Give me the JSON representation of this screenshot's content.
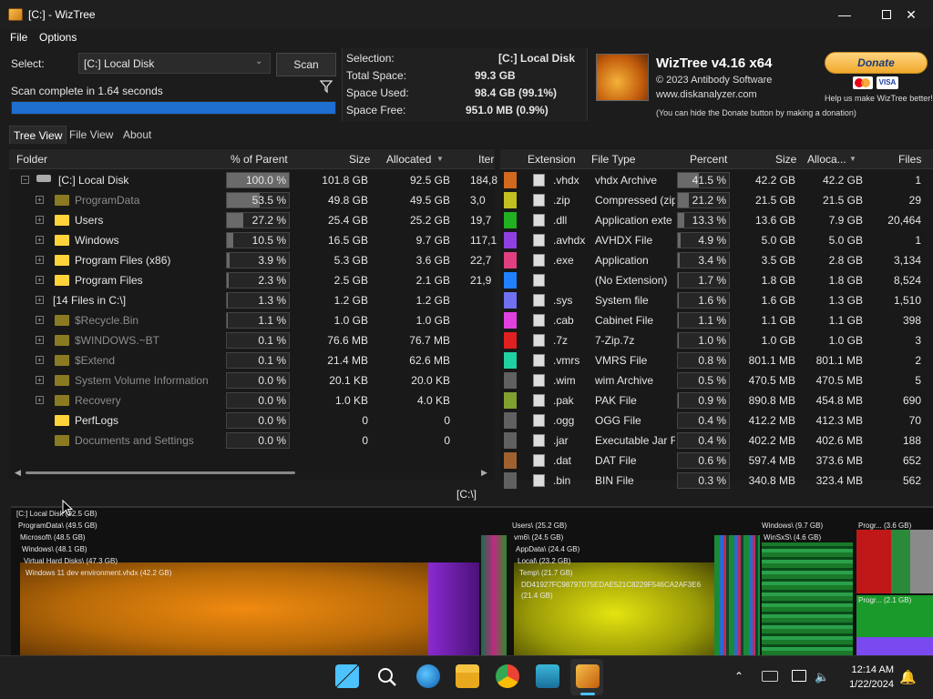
{
  "window": {
    "title": "[C:]  - WizTree",
    "min_icon": "minimize-icon",
    "max_icon": "maximize-icon",
    "close_icon": "close-icon"
  },
  "menu": {
    "file": "File",
    "options": "Options"
  },
  "scan": {
    "select_label": "Select:",
    "drive": "[C:] Local Disk",
    "scan_label": "Scan",
    "status": "Scan complete in 1.64 seconds",
    "progress": 1.0
  },
  "info": {
    "selection_label": "Selection:",
    "selection_value": "[C:]  Local Disk",
    "total_label": "Total Space:",
    "total_value": "99.3 GB",
    "used_label": "Space Used:",
    "used_value": "98.4 GB  (99.1%)",
    "free_label": "Space Free:",
    "free_value": "951.0 MB  (0.9%)"
  },
  "brand": {
    "name": "WizTree v4.16 x64",
    "copyright": "© 2023 Antibody Software",
    "url": "www.diskanalyzer.com",
    "note": "(You can hide the Donate button by making a donation)"
  },
  "donate": {
    "label": "Donate",
    "visa": "VISA",
    "help": "Help us make WizTree better!"
  },
  "tabs": [
    "Tree View",
    "File View",
    "About"
  ],
  "tree": {
    "headers": {
      "folder": "Folder",
      "pct": "% of Parent",
      "size": "Size",
      "allocated": "Allocated",
      "items": "Iter"
    },
    "rows": [
      {
        "name": "[C:] Local Disk",
        "pct": "100.0 %",
        "pct_val": 1.0,
        "size": "101.8 GB",
        "alloc": "92.5 GB",
        "items": "184,8",
        "kind": "drive"
      },
      {
        "name": "ProgramData",
        "pct": "53.5 %",
        "pct_val": 0.535,
        "size": "49.8 GB",
        "alloc": "49.5 GB",
        "items": "3,0",
        "kind": "sys"
      },
      {
        "name": "Users",
        "pct": "27.2 %",
        "pct_val": 0.272,
        "size": "25.4 GB",
        "alloc": "25.2 GB",
        "items": "19,7",
        "kind": "folder"
      },
      {
        "name": "Windows",
        "pct": "10.5 %",
        "pct_val": 0.105,
        "size": "16.5 GB",
        "alloc": "9.7 GB",
        "items": "117,1",
        "kind": "folder"
      },
      {
        "name": "Program Files (x86)",
        "pct": "3.9 %",
        "pct_val": 0.039,
        "size": "5.3 GB",
        "alloc": "3.6 GB",
        "items": "22,7",
        "kind": "folder"
      },
      {
        "name": "Program Files",
        "pct": "2.3 %",
        "pct_val": 0.023,
        "size": "2.5 GB",
        "alloc": "2.1 GB",
        "items": "21,9",
        "kind": "folder"
      },
      {
        "name": "[14 Files in C:\\]",
        "pct": "1.3 %",
        "pct_val": 0.013,
        "size": "1.2 GB",
        "alloc": "1.2 GB",
        "items": "",
        "kind": "files"
      },
      {
        "name": "$Recycle.Bin",
        "pct": "1.1 %",
        "pct_val": 0.011,
        "size": "1.0 GB",
        "alloc": "1.0 GB",
        "items": "",
        "kind": "sys"
      },
      {
        "name": "$WINDOWS.~BT",
        "pct": "0.1 %",
        "pct_val": 0.001,
        "size": "76.6 MB",
        "alloc": "76.7 MB",
        "items": "",
        "kind": "sys"
      },
      {
        "name": "$Extend",
        "pct": "0.1 %",
        "pct_val": 0.001,
        "size": "21.4 MB",
        "alloc": "62.6 MB",
        "items": "",
        "kind": "sys"
      },
      {
        "name": "System Volume Information",
        "pct": "0.0 %",
        "pct_val": 0.0,
        "size": "20.1 KB",
        "alloc": "20.0 KB",
        "items": "",
        "kind": "sys"
      },
      {
        "name": "Recovery",
        "pct": "0.0 %",
        "pct_val": 0.0,
        "size": "1.0 KB",
        "alloc": "4.0 KB",
        "items": "",
        "kind": "sys"
      },
      {
        "name": "PerfLogs",
        "pct": "0.0 %",
        "pct_val": 0.0,
        "size": "0",
        "alloc": "0",
        "items": "",
        "kind": "folder"
      },
      {
        "name": "Documents and Settings",
        "pct": "0.0 %",
        "pct_val": 0.0,
        "size": "0",
        "alloc": "0",
        "items": "",
        "kind": "sys"
      }
    ]
  },
  "ext": {
    "headers": {
      "extension": "Extension",
      "type": "File Type",
      "percent": "Percent",
      "size": "Size",
      "alloc": "Alloca...",
      "files": "Files"
    },
    "rows": [
      {
        "color": "#d2691e",
        "ext": ".vhdx",
        "type": "vhdx Archive",
        "pct": "41.5 %",
        "pct_val": 0.415,
        "size": "42.2 GB",
        "alloc": "42.2 GB",
        "files": "1"
      },
      {
        "color": "#c0c020",
        "ext": ".zip",
        "type": "Compressed (zip",
        "pct": "21.2 %",
        "pct_val": 0.212,
        "size": "21.5 GB",
        "alloc": "21.5 GB",
        "files": "29"
      },
      {
        "color": "#20b020",
        "ext": ".dll",
        "type": "Application exte",
        "pct": "13.3 %",
        "pct_val": 0.133,
        "size": "13.6 GB",
        "alloc": "7.9 GB",
        "files": "20,464"
      },
      {
        "color": "#9040e0",
        "ext": ".avhdx",
        "type": "AVHDX File",
        "pct": "4.9 %",
        "pct_val": 0.049,
        "size": "5.0 GB",
        "alloc": "5.0 GB",
        "files": "1"
      },
      {
        "color": "#e04080",
        "ext": ".exe",
        "type": "Application",
        "pct": "3.4 %",
        "pct_val": 0.034,
        "size": "3.5 GB",
        "alloc": "2.8 GB",
        "files": "3,134"
      },
      {
        "color": "#2080ff",
        "ext": "",
        "type": "(No Extension)",
        "pct": "1.7 %",
        "pct_val": 0.017,
        "size": "1.8 GB",
        "alloc": "1.8 GB",
        "files": "8,524"
      },
      {
        "color": "#7070f0",
        "ext": ".sys",
        "type": "System file",
        "pct": "1.6 %",
        "pct_val": 0.016,
        "size": "1.6 GB",
        "alloc": "1.3 GB",
        "files": "1,510"
      },
      {
        "color": "#e040e0",
        "ext": ".cab",
        "type": "Cabinet File",
        "pct": "1.1 %",
        "pct_val": 0.011,
        "size": "1.1 GB",
        "alloc": "1.1 GB",
        "files": "398"
      },
      {
        "color": "#e02020",
        "ext": ".7z",
        "type": "7-Zip.7z",
        "pct": "1.0 %",
        "pct_val": 0.01,
        "size": "1.0 GB",
        "alloc": "1.0 GB",
        "files": "3"
      },
      {
        "color": "#20d0a0",
        "ext": ".vmrs",
        "type": "VMRS File",
        "pct": "0.8 %",
        "pct_val": 0.008,
        "size": "801.1 MB",
        "alloc": "801.1 MB",
        "files": "2"
      },
      {
        "color": "#606060",
        "ext": ".wim",
        "type": "wim Archive",
        "pct": "0.5 %",
        "pct_val": 0.005,
        "size": "470.5 MB",
        "alloc": "470.5 MB",
        "files": "5"
      },
      {
        "color": "#80a030",
        "ext": ".pak",
        "type": "PAK File",
        "pct": "0.9 %",
        "pct_val": 0.009,
        "size": "890.8 MB",
        "alloc": "454.8 MB",
        "files": "690"
      },
      {
        "color": "#606060",
        "ext": ".ogg",
        "type": "OGG File",
        "pct": "0.4 %",
        "pct_val": 0.004,
        "size": "412.2 MB",
        "alloc": "412.3 MB",
        "files": "70"
      },
      {
        "color": "#606060",
        "ext": ".jar",
        "type": "Executable Jar Fi",
        "pct": "0.4 %",
        "pct_val": 0.004,
        "size": "402.2 MB",
        "alloc": "402.6 MB",
        "files": "188"
      },
      {
        "color": "#a06030",
        "ext": ".dat",
        "type": "DAT File",
        "pct": "0.6 %",
        "pct_val": 0.006,
        "size": "597.4 MB",
        "alloc": "373.6 MB",
        "files": "652"
      },
      {
        "color": "#606060",
        "ext": ".bin",
        "type": "BIN File",
        "pct": "0.3 %",
        "pct_val": 0.003,
        "size": "340.8 MB",
        "alloc": "323.4 MB",
        "files": "562"
      }
    ]
  },
  "path": "[C:\\]",
  "treemap": {
    "labels": [
      "[C:] Local Disk (92.5 GB)",
      "ProgramData\\ (49.5 GB)",
      "Microsoft\\ (48.5 GB)",
      "Windows\\ (48.1 GB)",
      "Virtual Hard Disks\\ (47.3 GB)",
      "Windows 11 dev environment.vhdx (42.2 GB)",
      "Users\\ (25.2 GB)",
      "vm6\\ (24.5 GB)",
      "AppData\\ (24.4 GB)",
      "Local\\ (23.2 GB)",
      "Temp\\ (21.7 GB)",
      "DD41927FC98797075EDAE521C8229F546CA2AF3E6",
      "(21.4 GB)",
      "Windows\\ (9.7 GB)",
      "WinSxS\\ (4.6 GB)",
      "Progr... (3.6 GB)",
      "Progr... (2.1 GB)"
    ]
  },
  "taskbar": {
    "time": "12:14 AM",
    "date": "1/22/2024"
  }
}
